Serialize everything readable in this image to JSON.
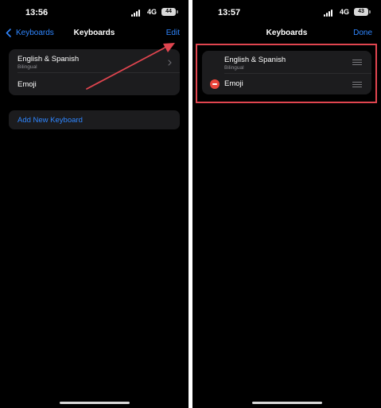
{
  "left_screen": {
    "status": {
      "time": "13:56",
      "network": "4G",
      "battery": "44"
    },
    "nav": {
      "back_label": "Keyboards",
      "title": "Keyboards",
      "action_label": "Edit"
    },
    "keyboards": [
      {
        "title": "English & Spanish",
        "subtitle": "Bilingual"
      },
      {
        "title": "Emoji"
      }
    ],
    "add_keyboard_label": "Add New Keyboard"
  },
  "right_screen": {
    "status": {
      "time": "13:57",
      "network": "4G",
      "battery": "43"
    },
    "nav": {
      "title": "Keyboards",
      "action_label": "Done"
    },
    "keyboards": [
      {
        "title": "English & Spanish",
        "subtitle": "Bilingual"
      },
      {
        "title": "Emoji"
      }
    ]
  },
  "colors": {
    "accent": "#2f86ff",
    "background": "#000000",
    "group_background": "#1c1c1e",
    "delete_red": "#e9453b",
    "annotation_red": "#e0454f"
  },
  "icons": [
    "back-chevron-icon",
    "chevron-right-icon",
    "signal-icon",
    "battery-icon",
    "reorder-icon",
    "delete-icon"
  ]
}
